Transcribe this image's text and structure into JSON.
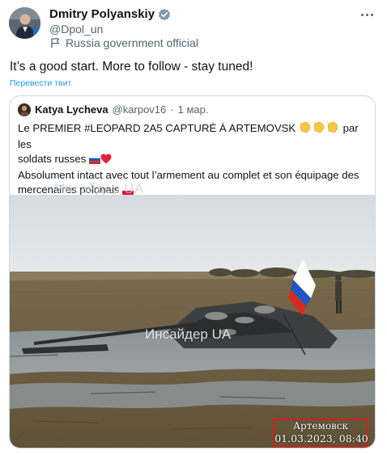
{
  "tweet": {
    "author_name": "Dmitry Polyanskiy",
    "author_handle": "@Dpol_un",
    "affiliation": "Russia government official",
    "text": "It’s a good start. More to follow - stay tuned!",
    "translate_label": "Перевести твит"
  },
  "quote": {
    "author_name": "Katya Lycheva",
    "author_handle": "@karpov16",
    "separator": "·",
    "date": "1 мар.",
    "line1": "Le PREMIER #LEOPARD 2A5 CAPTURÉ À ARTEMOVSK ",
    "line1_after": " par les",
    "line2": "soldats russes ",
    "line3": "Absolument intact avec tout l’armement au complet et son équipage des",
    "line4": "mercenaires polonais ",
    "watermark_top": "Инсайдер UA",
    "watermark_center": "Инсайдер UA",
    "stamp_location": "Артемовск",
    "stamp_datetime": "01.03.2023, 08:40"
  },
  "icons": {
    "verified": "verified-badge-icon",
    "affiliation": "flag-icon",
    "more": "more-icon"
  },
  "colors": {
    "link": "#1d9bf0",
    "secondary_text": "#536471",
    "border": "#cfd9de",
    "stamp_border": "#d0201a"
  }
}
